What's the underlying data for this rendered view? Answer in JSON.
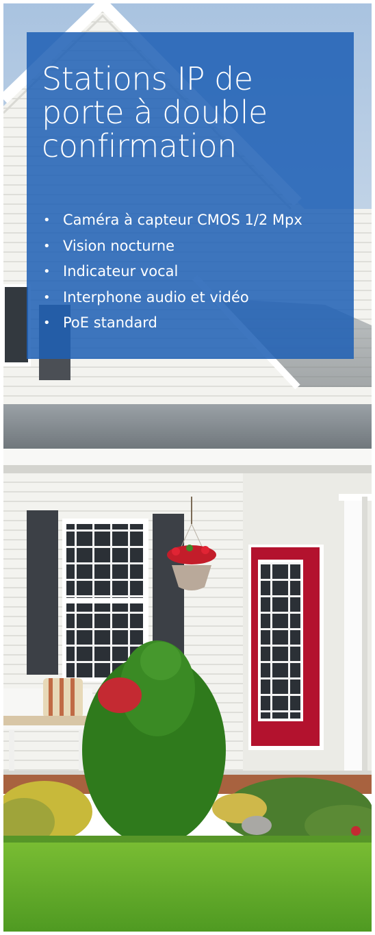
{
  "panel": {
    "title_lines": [
      "Stations IP de",
      "porte à double",
      "confirmation"
    ],
    "bullet_glyph": "•",
    "features": [
      "Caméra à capteur CMOS 1/2 Mpx",
      "Vision nocturne",
      "Indicateur vocal",
      "Interphone audio et vidéo",
      "PoE standard"
    ]
  },
  "colors": {
    "panel_blue": "#1e60b4",
    "sky": "#b9cde3",
    "siding": "#f2f2ee",
    "door_red": "#b3122e",
    "shutter": "#3e4248",
    "lawn": "#6cae2c",
    "shrub": "#2f7a1c"
  }
}
